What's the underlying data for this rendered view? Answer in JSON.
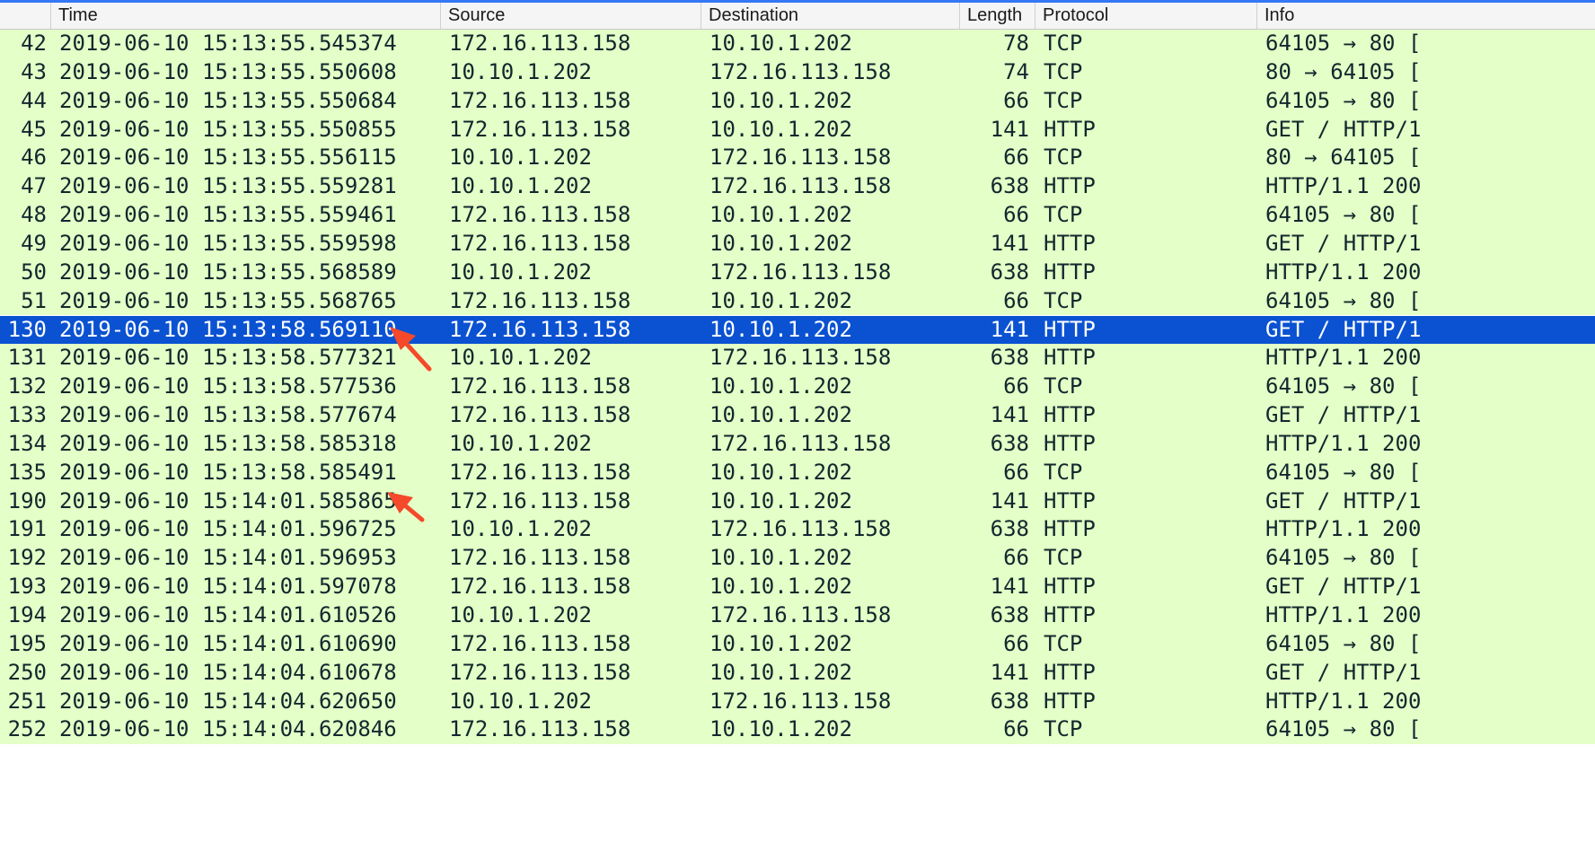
{
  "columns": {
    "no": "",
    "time": "Time",
    "source": "Source",
    "destination": "Destination",
    "length": "Length",
    "protocol": "Protocol",
    "info": "Info"
  },
  "colors": {
    "row_bg": "#e4ffc7",
    "selected_bg": "#0a52d2",
    "annotation_arrow": "#f4492a"
  },
  "selected_row_index": 10,
  "packets": [
    {
      "no": "42",
      "time": "2019-06-10 15:13:55.545374",
      "source": "172.16.113.158",
      "destination": "10.10.1.202",
      "length": "78",
      "protocol": "TCP",
      "info": "64105 → 80 ["
    },
    {
      "no": "43",
      "time": "2019-06-10 15:13:55.550608",
      "source": "10.10.1.202",
      "destination": "172.16.113.158",
      "length": "74",
      "protocol": "TCP",
      "info": "80 → 64105 ["
    },
    {
      "no": "44",
      "time": "2019-06-10 15:13:55.550684",
      "source": "172.16.113.158",
      "destination": "10.10.1.202",
      "length": "66",
      "protocol": "TCP",
      "info": "64105 → 80 ["
    },
    {
      "no": "45",
      "time": "2019-06-10 15:13:55.550855",
      "source": "172.16.113.158",
      "destination": "10.10.1.202",
      "length": "141",
      "protocol": "HTTP",
      "info": "GET / HTTP/1"
    },
    {
      "no": "46",
      "time": "2019-06-10 15:13:55.556115",
      "source": "10.10.1.202",
      "destination": "172.16.113.158",
      "length": "66",
      "protocol": "TCP",
      "info": "80 → 64105 ["
    },
    {
      "no": "47",
      "time": "2019-06-10 15:13:55.559281",
      "source": "10.10.1.202",
      "destination": "172.16.113.158",
      "length": "638",
      "protocol": "HTTP",
      "info": "HTTP/1.1 200"
    },
    {
      "no": "48",
      "time": "2019-06-10 15:13:55.559461",
      "source": "172.16.113.158",
      "destination": "10.10.1.202",
      "length": "66",
      "protocol": "TCP",
      "info": "64105 → 80 ["
    },
    {
      "no": "49",
      "time": "2019-06-10 15:13:55.559598",
      "source": "172.16.113.158",
      "destination": "10.10.1.202",
      "length": "141",
      "protocol": "HTTP",
      "info": "GET / HTTP/1"
    },
    {
      "no": "50",
      "time": "2019-06-10 15:13:55.568589",
      "source": "10.10.1.202",
      "destination": "172.16.113.158",
      "length": "638",
      "protocol": "HTTP",
      "info": "HTTP/1.1 200"
    },
    {
      "no": "51",
      "time": "2019-06-10 15:13:55.568765",
      "source": "172.16.113.158",
      "destination": "10.10.1.202",
      "length": "66",
      "protocol": "TCP",
      "info": "64105 → 80 ["
    },
    {
      "no": "130",
      "time": "2019-06-10 15:13:58.569110",
      "source": "172.16.113.158",
      "destination": "10.10.1.202",
      "length": "141",
      "protocol": "HTTP",
      "info": "GET / HTTP/1"
    },
    {
      "no": "131",
      "time": "2019-06-10 15:13:58.577321",
      "source": "10.10.1.202",
      "destination": "172.16.113.158",
      "length": "638",
      "protocol": "HTTP",
      "info": "HTTP/1.1 200"
    },
    {
      "no": "132",
      "time": "2019-06-10 15:13:58.577536",
      "source": "172.16.113.158",
      "destination": "10.10.1.202",
      "length": "66",
      "protocol": "TCP",
      "info": "64105 → 80 ["
    },
    {
      "no": "133",
      "time": "2019-06-10 15:13:58.577674",
      "source": "172.16.113.158",
      "destination": "10.10.1.202",
      "length": "141",
      "protocol": "HTTP",
      "info": "GET / HTTP/1"
    },
    {
      "no": "134",
      "time": "2019-06-10 15:13:58.585318",
      "source": "10.10.1.202",
      "destination": "172.16.113.158",
      "length": "638",
      "protocol": "HTTP",
      "info": "HTTP/1.1 200"
    },
    {
      "no": "135",
      "time": "2019-06-10 15:13:58.585491",
      "source": "172.16.113.158",
      "destination": "10.10.1.202",
      "length": "66",
      "protocol": "TCP",
      "info": "64105 → 80 ["
    },
    {
      "no": "190",
      "time": "2019-06-10 15:14:01.585865",
      "source": "172.16.113.158",
      "destination": "10.10.1.202",
      "length": "141",
      "protocol": "HTTP",
      "info": "GET / HTTP/1"
    },
    {
      "no": "191",
      "time": "2019-06-10 15:14:01.596725",
      "source": "10.10.1.202",
      "destination": "172.16.113.158",
      "length": "638",
      "protocol": "HTTP",
      "info": "HTTP/1.1 200"
    },
    {
      "no": "192",
      "time": "2019-06-10 15:14:01.596953",
      "source": "172.16.113.158",
      "destination": "10.10.1.202",
      "length": "66",
      "protocol": "TCP",
      "info": "64105 → 80 ["
    },
    {
      "no": "193",
      "time": "2019-06-10 15:14:01.597078",
      "source": "172.16.113.158",
      "destination": "10.10.1.202",
      "length": "141",
      "protocol": "HTTP",
      "info": "GET / HTTP/1"
    },
    {
      "no": "194",
      "time": "2019-06-10 15:14:01.610526",
      "source": "10.10.1.202",
      "destination": "172.16.113.158",
      "length": "638",
      "protocol": "HTTP",
      "info": "HTTP/1.1 200"
    },
    {
      "no": "195",
      "time": "2019-06-10 15:14:01.610690",
      "source": "172.16.113.158",
      "destination": "10.10.1.202",
      "length": "66",
      "protocol": "TCP",
      "info": "64105 → 80 ["
    },
    {
      "no": "250",
      "time": "2019-06-10 15:14:04.610678",
      "source": "172.16.113.158",
      "destination": "10.10.1.202",
      "length": "141",
      "protocol": "HTTP",
      "info": "GET / HTTP/1"
    },
    {
      "no": "251",
      "time": "2019-06-10 15:14:04.620650",
      "source": "10.10.1.202",
      "destination": "172.16.113.158",
      "length": "638",
      "protocol": "HTTP",
      "info": "HTTP/1.1 200"
    },
    {
      "no": "252",
      "time": "2019-06-10 15:14:04.620846",
      "source": "172.16.113.158",
      "destination": "10.10.1.202",
      "length": "66",
      "protocol": "TCP",
      "info": "64105 → 80 ["
    }
  ]
}
